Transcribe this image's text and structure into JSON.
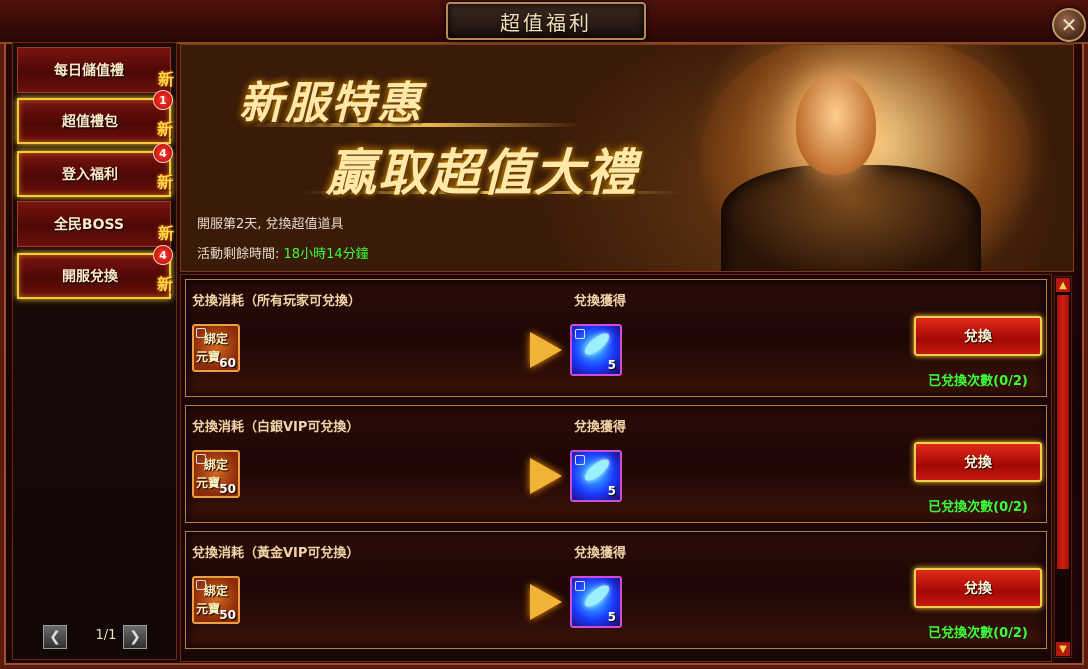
{
  "window": {
    "title": "超值福利",
    "close_label": "✕"
  },
  "sidebar": {
    "new_tag": "新",
    "items": [
      {
        "label": "每日儲值禮",
        "badge": ""
      },
      {
        "label": "超值禮包",
        "badge": "1"
      },
      {
        "label": "登入福利",
        "badge": "4"
      },
      {
        "label": "全民BOSS",
        "badge": ""
      },
      {
        "label": "開服兌換",
        "badge": "4"
      }
    ],
    "pager": {
      "prev_icon": "❮",
      "text": "1/1",
      "next_icon": "❯"
    }
  },
  "banner": {
    "headline1": "新服特惠",
    "headline2": "贏取超值大禮",
    "subtitle": "開服第2天, 兌換超值道具",
    "remaining_label": "活動剩餘時間:",
    "remaining_time": "18小時14分鐘"
  },
  "exchange": {
    "get_label": "兌換獲得",
    "button_label": "兌換",
    "rows": [
      {
        "cost_label": "兌換消耗（所有玩家可兌換）",
        "token_line1": "綁定",
        "token_line2": "元寶",
        "cost_qty": "60",
        "reward_qty": "5",
        "count": "已兌換次數(0/2)"
      },
      {
        "cost_label": "兌換消耗（白銀VIP可兌換）",
        "token_line1": "綁定",
        "token_line2": "元寶",
        "cost_qty": "50",
        "reward_qty": "5",
        "count": "已兌換次數(0/2)"
      },
      {
        "cost_label": "兌換消耗（黃金VIP可兌換）",
        "token_line1": "綁定",
        "token_line2": "元寶",
        "cost_qty": "50",
        "reward_qty": "5",
        "count": "已兌換次數(0/2)"
      }
    ]
  },
  "scrollbar": {
    "up_icon": "▲",
    "down_icon": "▼"
  },
  "colors": {
    "accent_gold": "#f5d04a",
    "highlight_green": "#3cff3c",
    "button_red": "#c81810"
  }
}
